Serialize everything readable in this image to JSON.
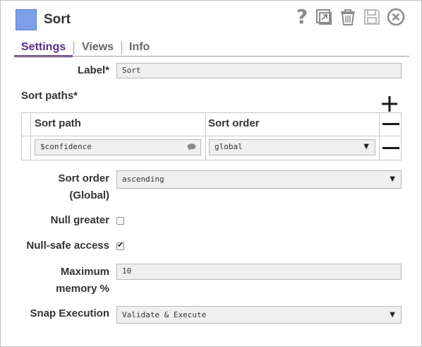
{
  "header": {
    "title": "Sort"
  },
  "tabs": [
    {
      "label": "Settings"
    },
    {
      "label": "Views"
    },
    {
      "label": "Info"
    }
  ],
  "form": {
    "label": {
      "label": "Label*",
      "value": "Sort"
    },
    "sort_paths": {
      "label": "Sort paths*",
      "columns": [
        "Sort path",
        "Sort order"
      ],
      "rows": [
        {
          "path": "$confidence",
          "order": "global"
        }
      ]
    },
    "sort_order_global": {
      "label_line1": "Sort order",
      "label_line2": "(Global)",
      "value": "ascending"
    },
    "null_greater": {
      "label": "Null greater",
      "checked": false
    },
    "null_safe_access": {
      "label": "Null-safe access",
      "checked": true
    },
    "max_memory": {
      "label_line1": "Maximum",
      "label_line2": "memory %",
      "value": "10"
    },
    "snap_execution": {
      "label": "Snap Execution",
      "value": "Validate & Execute"
    }
  },
  "colors": {
    "accent": "#5a2d82",
    "snap_icon": "#7b9fe8",
    "icon_gray": "#8a8a8a"
  },
  "icons": [
    "help-icon",
    "export-icon",
    "delete-icon",
    "save-icon",
    "close-icon",
    "add-icon",
    "remove-icon",
    "comment-icon"
  ]
}
